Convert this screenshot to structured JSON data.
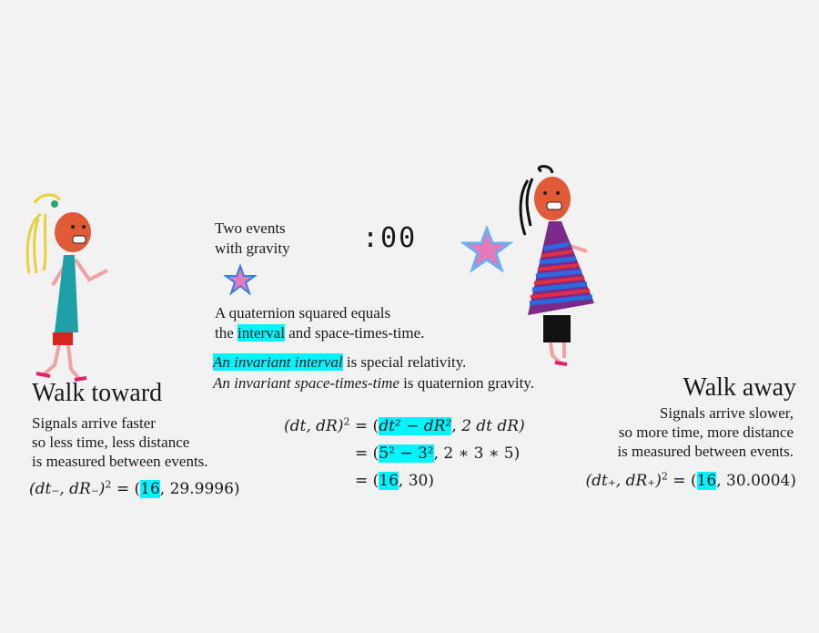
{
  "title": {
    "line1": "Two events",
    "line2": "with gravity"
  },
  "timer": ":00",
  "p1": {
    "line1": "A quaternion squared equals",
    "pre": "the ",
    "hl": "interval",
    "post": " and space-times-time."
  },
  "p2": {
    "hl": "An invariant interval",
    "l1post": " is special relativity.",
    "l2it": "An invariant space-times-time",
    "l2post": " is quaternion gravity."
  },
  "left": {
    "heading": "Walk toward",
    "body": [
      "Signals arrive faster",
      "so less time, less distance",
      "is measured between events."
    ],
    "eq_lhs": "(dt₋, dR₋)",
    "eq_val1": "16",
    "eq_val2": ", 29.9996)"
  },
  "right": {
    "heading": "Walk away",
    "body": [
      "Signals arrive slower,",
      "so more time, more distance",
      "is measured between events."
    ],
    "eq_lhs": "(dt₊, dR₊)",
    "eq_val1": "16",
    "eq_val2": ", 30.0004)"
  },
  "center": {
    "lhs": "(dt, dR)",
    "r1a": "dt² − dR²",
    "r1b": ", 2 dt dR)",
    "r2a": "5² − 3²",
    "r2b": ", 2 ∗ 3 ∗ 5)",
    "r3a": "16",
    "r3b": ", 30)"
  },
  "colors": {
    "highlight": "#00f5ff",
    "star_fill": "#e879b8",
    "star_edge": "#6aaef0"
  }
}
